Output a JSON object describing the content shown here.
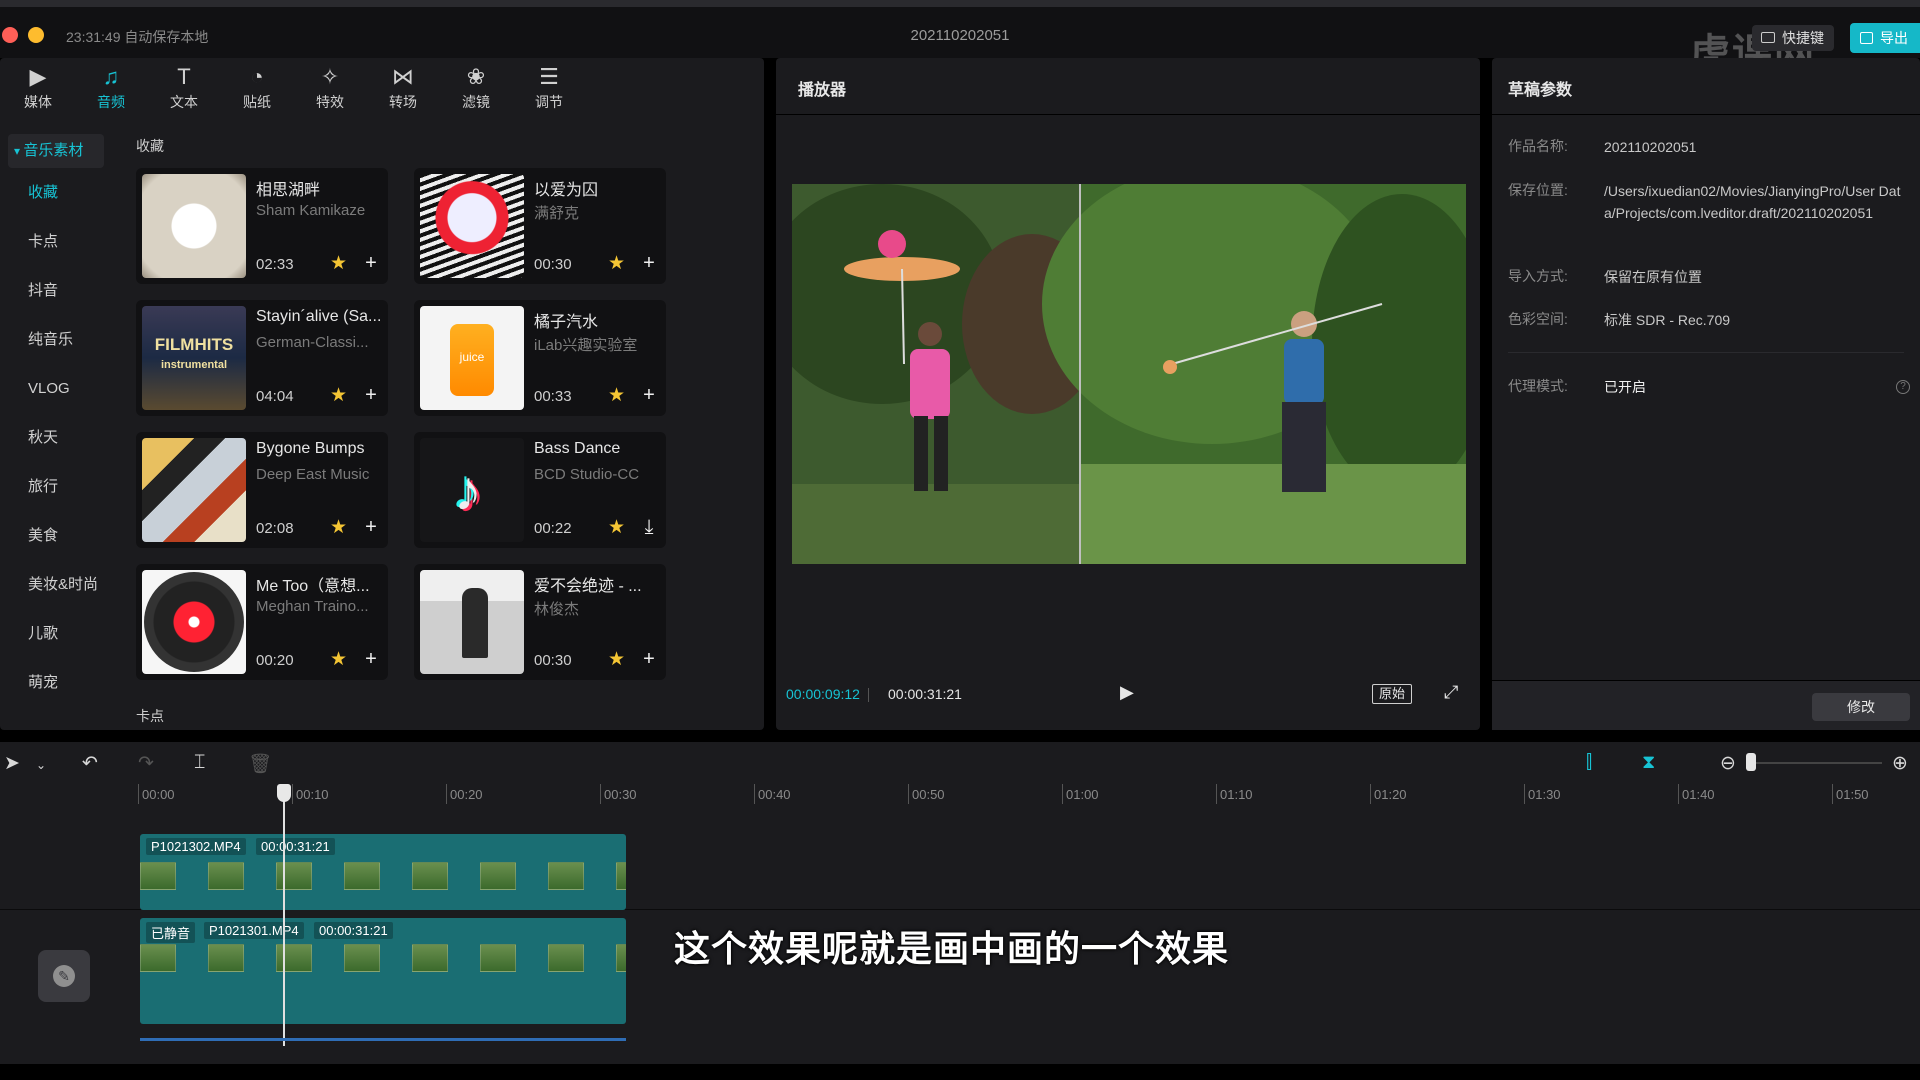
{
  "titlebar": {
    "autosave": "23:31:49 自动保存本地",
    "project_title": "202110202051",
    "shortcut_label": "快捷键",
    "export_label": "导出",
    "watermark": "虎课网"
  },
  "toolbar": {
    "tools": [
      {
        "label": "媒体",
        "icon": "media-icon"
      },
      {
        "label": "音频",
        "icon": "audio-icon"
      },
      {
        "label": "文本",
        "icon": "text-icon"
      },
      {
        "label": "贴纸",
        "icon": "sticker-icon"
      },
      {
        "label": "特效",
        "icon": "effects-icon"
      },
      {
        "label": "转场",
        "icon": "transition-icon"
      },
      {
        "label": "滤镜",
        "icon": "filter-icon"
      },
      {
        "label": "调节",
        "icon": "adjust-icon"
      }
    ],
    "active": "音频"
  },
  "categories": {
    "header": "音乐素材",
    "items": [
      "收藏",
      "卡点",
      "抖音",
      "纯音乐",
      "VLOG",
      "秋天",
      "旅行",
      "美食",
      "美妆&时尚",
      "儿歌",
      "萌宠"
    ],
    "active": "收藏"
  },
  "library": {
    "section_favorites": "收藏",
    "section_next": "卡点",
    "tracks": [
      {
        "title": "相思湖畔",
        "artist": "Sham Kamikaze",
        "duration": "02:33",
        "action": "add"
      },
      {
        "title": "以爱为囚",
        "artist": "满舒克",
        "duration": "00:30",
        "action": "add"
      },
      {
        "title": "Stayin´alive (Sa...",
        "artist": "German-Classi...",
        "duration": "04:04",
        "action": "add"
      },
      {
        "title": "橘子汽水",
        "artist": "iLab兴趣实验室",
        "duration": "00:33",
        "action": "add"
      },
      {
        "title": "Bygone Bumps",
        "artist": "Deep East Music",
        "duration": "02:08",
        "action": "add"
      },
      {
        "title": "Bass Dance",
        "artist": "BCD Studio-CC",
        "duration": "00:22",
        "action": "download"
      },
      {
        "title": "Me Too（意想...",
        "artist": "Meghan Traino...",
        "duration": "00:20",
        "action": "add"
      },
      {
        "title": "爱不会绝迹 - ...",
        "artist": "林俊杰",
        "duration": "00:30",
        "action": "add"
      }
    ],
    "thumb_texts": [
      "FILMHITS",
      "instrumental",
      "juice"
    ]
  },
  "player": {
    "title": "播放器",
    "current_time": "00:00:09:12",
    "total_time": "00:00:31:21",
    "original_label": "原始"
  },
  "params": {
    "title": "草稿参数",
    "rows": [
      {
        "key": "作品名称:",
        "value": "202110202051"
      },
      {
        "key": "保存位置:",
        "value": "/Users/ixuedian02/Movies/JianyingPro/User Data/Projects/com.lveditor.draft/202110202051"
      },
      {
        "key": "导入方式:",
        "value": "保留在原有位置"
      },
      {
        "key": "色彩空间:",
        "value": "标准 SDR - Rec.709"
      }
    ],
    "proxy_key": "代理模式:",
    "proxy_value": "已开启",
    "modify_label": "修改"
  },
  "timeline": {
    "ticks": [
      "00:00",
      "00:10",
      "00:20",
      "00:30",
      "00:40",
      "00:50",
      "01:00",
      "01:10",
      "01:20",
      "01:30",
      "01:40",
      "01:50"
    ],
    "clip1": {
      "name": "P1021302.MP4",
      "duration": "00:00:31:21"
    },
    "clip2": {
      "muted": "已静音",
      "name": "P1021301.MP4",
      "duration": "00:00:31:21"
    },
    "subtitle": "这个效果呢就是画中画的一个效果"
  },
  "colors": {
    "accent": "#17c3d4",
    "clip": "#1a6e73",
    "star": "#f4c534"
  }
}
